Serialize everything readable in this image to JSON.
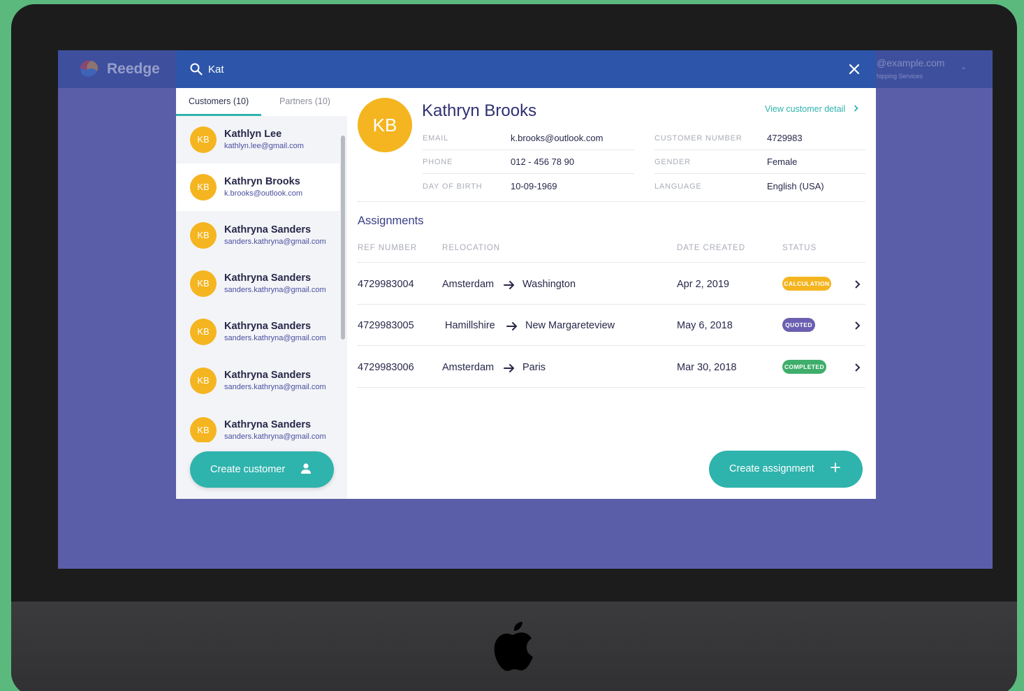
{
  "app": {
    "brand": "Reedge",
    "account_email": "@example.com",
    "account_sub": "hipping Services"
  },
  "search": {
    "value": "Kat"
  },
  "tabs": [
    {
      "label": "Customers (10)"
    },
    {
      "label": "Partners (10)"
    }
  ],
  "customers": [
    {
      "initials": "KB",
      "name": "Kathlyn Lee",
      "email": "kathlyn.lee@gmail.com"
    },
    {
      "initials": "KB",
      "name": "Kathryn Brooks",
      "email": "k.brooks@outlook.com"
    },
    {
      "initials": "KB",
      "name": "Kathryna Sanders",
      "email": "sanders.kathryna@gmail.com"
    },
    {
      "initials": "KB",
      "name": "Kathryna Sanders",
      "email": "sanders.kathryna@gmail.com"
    },
    {
      "initials": "KB",
      "name": "Kathryna Sanders",
      "email": "sanders.kathryna@gmail.com"
    },
    {
      "initials": "KB",
      "name": "Kathryna Sanders",
      "email": "sanders.kathryna@gmail.com"
    },
    {
      "initials": "KB",
      "name": "Kathryna Sanders",
      "email": "sanders.kathryna@gmail.com"
    }
  ],
  "create_customer": {
    "label": "Create customer"
  },
  "detail": {
    "initials": "KB",
    "name": "Kathryn Brooks",
    "view_link": "View customer detail",
    "fields": {
      "email_label": "EMAIL",
      "email": "k.brooks@outlook.com",
      "phone_label": "PHONE",
      "phone": "012 - 456 78 90",
      "dob_label": "DAY OF BIRTH",
      "dob": "10-09-1969",
      "number_label": "CUSTOMER NUMBER",
      "number": "4729983",
      "gender_label": "GENDER",
      "gender": "Female",
      "language_label": "LANGUAGE",
      "language": "English (USA)"
    }
  },
  "assignments": {
    "title": "Assignments",
    "headers": {
      "ref": "REF NUMBER",
      "relocation": "RELOCATION",
      "date": "DATE CREATED",
      "status": "STATUS"
    },
    "rows": [
      {
        "ref": "4729983004",
        "from": "Amsterdam",
        "to": "Washington",
        "date": "Apr 2, 2019",
        "status": "CALCULATION"
      },
      {
        "ref": "4729983005",
        "from": "Hamillshire",
        "to": "New Margareteview",
        "date": "May 6, 2018",
        "status": "QUOTED"
      },
      {
        "ref": "4729983006",
        "from": "Amsterdam",
        "to": "Paris",
        "date": "Mar 30, 2018",
        "status": "COMPLETED"
      }
    ]
  },
  "create_assignment": {
    "label": "Create assignment"
  },
  "colors": {
    "accent": "#2fb3ad",
    "avatar": "#f4b520",
    "calculation": "#f4b520",
    "quoted": "#6a5fb0",
    "completed": "#3fae6b",
    "search_bar": "#2d56aa",
    "backdrop": "#5a5ea8",
    "title": "#2f2f72"
  }
}
